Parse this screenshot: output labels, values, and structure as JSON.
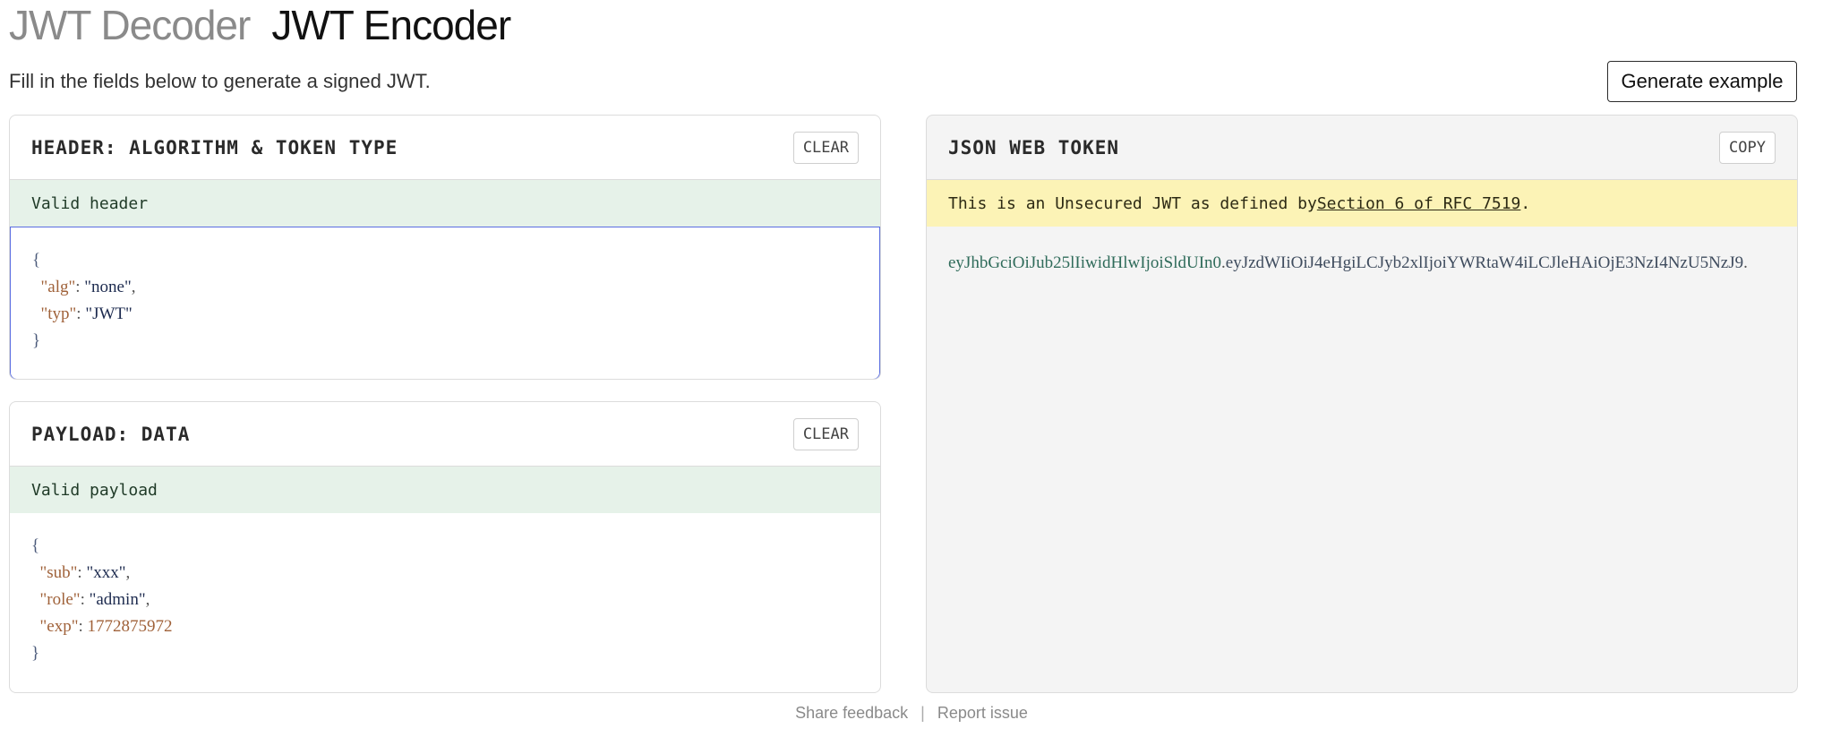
{
  "tabs": {
    "decoder": "JWT Decoder",
    "encoder": "JWT Encoder"
  },
  "subtitle": "Fill in the fields below to generate a signed JWT.",
  "generate_button": "Generate example",
  "header_panel": {
    "title": "HEADER: ALGORITHM & TOKEN TYPE",
    "clear_label": "CLEAR",
    "status": "Valid header",
    "json": {
      "open": "{",
      "close": "}",
      "fields": [
        {
          "key": "\"alg\"",
          "value": "\"none\"",
          "trail": ","
        },
        {
          "key": "\"typ\"",
          "value": "\"JWT\"",
          "trail": ""
        }
      ]
    }
  },
  "payload_panel": {
    "title": "PAYLOAD: DATA",
    "clear_label": "CLEAR",
    "status": "Valid payload",
    "json": {
      "open": "{",
      "close": "}",
      "fields": [
        {
          "key": "\"sub\"",
          "value": "\"xxx\"",
          "trail": ","
        },
        {
          "key": "\"role\"",
          "value": "\"admin\"",
          "trail": ","
        },
        {
          "key": "\"exp\"",
          "value": "1772875972",
          "trail": ""
        }
      ]
    }
  },
  "token_panel": {
    "title": "JSON WEB TOKEN",
    "copy_label": "COPY",
    "notice_prefix": "This is an Unsecured JWT as defined by ",
    "notice_link": "Section 6 of RFC 7519",
    "notice_suffix": ".",
    "token_header": "eyJhbGciOiJub25lIiwidHlwIjoiSldUIn0",
    "token_payload": "eyJzdWIiOiJ4eHgiLCJyb2xlIjoiYWRtaW4iLCJleHAiOjE3NzI4NzU5NzJ9",
    "dot": "."
  },
  "footer": {
    "feedback": "Share feedback",
    "separator": "|",
    "report": "Report issue"
  },
  "colors": {
    "valid_bg": "#e6f2e9",
    "warn_bg": "#fcf3b6",
    "focus_border": "#5b6ee1",
    "json_key": "#a0623a"
  }
}
